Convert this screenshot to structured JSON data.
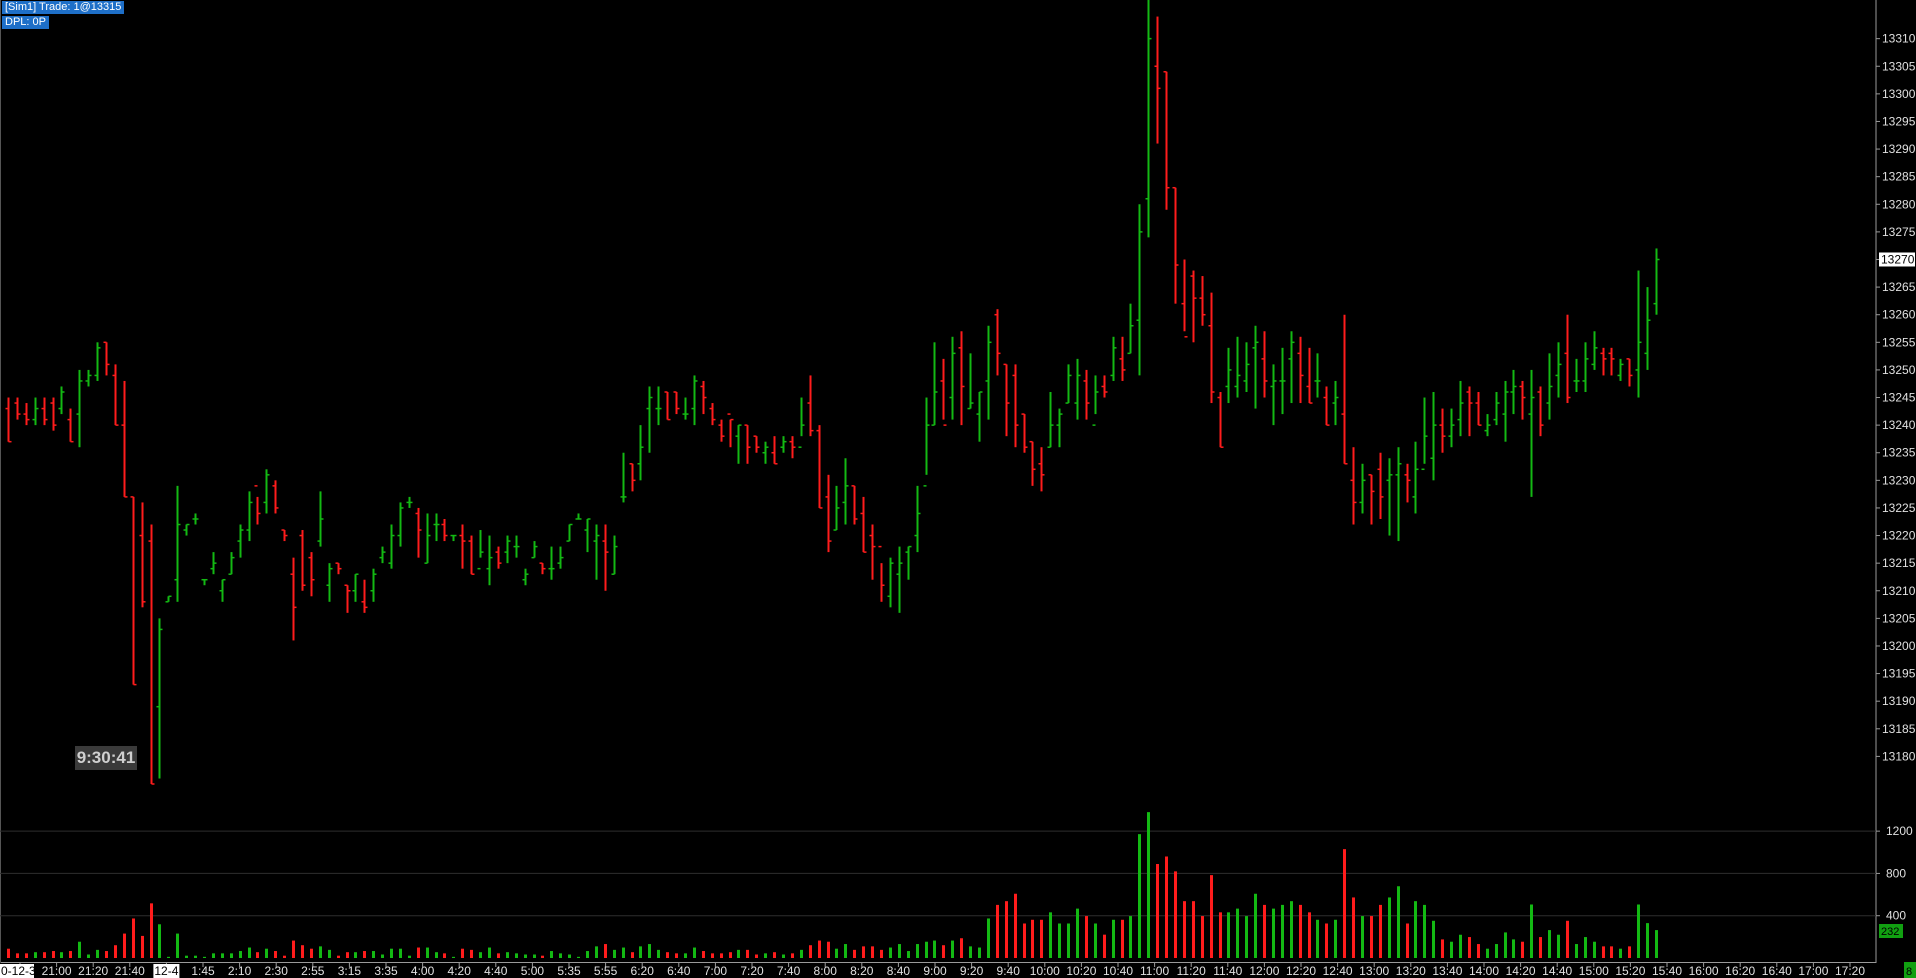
{
  "status": {
    "line1": "[Sim1]  Trade: 1@13315",
    "line2": "DPL: 0P"
  },
  "time_box": "9:30:41",
  "chart_data": [
    {
      "type": "ohlc",
      "price_axis": {
        "ticks": [
          13180,
          13185,
          13190,
          13195,
          13200,
          13205,
          13210,
          13215,
          13220,
          13225,
          13230,
          13235,
          13240,
          13245,
          13250,
          13255,
          13260,
          13265,
          13270,
          13275,
          13280,
          13285,
          13290,
          13295,
          13300,
          13305,
          13310
        ],
        "range": [
          13175,
          13317
        ],
        "current_price": "13270"
      },
      "time_axis": [
        "0-12-3",
        "21:00",
        "21:20",
        "21:40",
        "12-4",
        "1:45",
        "2:10",
        "2:30",
        "2:55",
        "3:15",
        "3:35",
        "4:00",
        "4:20",
        "4:40",
        "5:00",
        "5:35",
        "5:55",
        "6:20",
        "6:40",
        "7:00",
        "7:20",
        "7:40",
        "8:00",
        "8:20",
        "8:40",
        "9:00",
        "9:20",
        "9:40",
        "10:00",
        "10:20",
        "10:40",
        "11:00",
        "11:20",
        "11:40",
        "12:00",
        "12:20",
        "12:40",
        "13:00",
        "13:20",
        "13:40",
        "14:00",
        "14:20",
        "14:40",
        "15:00",
        "15:20",
        "15:40",
        "16:00",
        "16:20",
        "16:40",
        "17:00",
        "17:20"
      ],
      "bars": [
        [
          13243,
          13237,
          13245,
          13237
        ],
        [
          13244,
          13242,
          13245,
          13241
        ],
        [
          13242,
          13241,
          13244,
          13240
        ],
        [
          13241,
          13243,
          13245,
          13240
        ],
        [
          13243,
          13241,
          13245,
          13240
        ],
        [
          13244,
          13240,
          13245,
          13239
        ],
        [
          13243,
          13246,
          13247,
          13242
        ],
        [
          13241,
          13237,
          13243,
          13237
        ],
        [
          13242,
          13248,
          13250,
          13236
        ],
        [
          13248,
          13249,
          13250,
          13247
        ],
        [
          13249,
          13254,
          13255,
          13248
        ],
        [
          13255,
          13251,
          13255,
          13249
        ],
        [
          13249,
          13240,
          13251,
          13240
        ],
        [
          13240,
          13227,
          13248,
          13227
        ],
        [
          13227,
          13193,
          13227,
          13193
        ],
        [
          13220,
          13208,
          13226,
          13207
        ],
        [
          13219,
          13175,
          13222,
          13175
        ],
        [
          13189,
          13203,
          13205,
          13176
        ],
        [
          13208,
          13209,
          13209,
          13208
        ],
        [
          13212,
          13222,
          13229,
          13208
        ],
        [
          13221,
          13222,
          13222,
          13220
        ],
        [
          13223,
          13223,
          13224,
          13222
        ],
        [
          13212,
          13212,
          13212,
          13211
        ],
        [
          13214,
          13215,
          13217,
          13213
        ],
        [
          13210,
          13212,
          13212,
          13208
        ],
        [
          13213,
          13216,
          13217,
          13213
        ],
        [
          13219,
          13221,
          13222,
          13216
        ],
        [
          13221,
          13226,
          13228,
          13219
        ],
        [
          13229,
          13224,
          13227,
          13222
        ],
        [
          13226,
          13231,
          13232,
          13224
        ],
        [
          13229,
          13225,
          13230,
          13224
        ],
        [
          13221,
          13220,
          13221,
          13219
        ],
        [
          13213,
          13207,
          13216,
          13201
        ],
        [
          13220,
          13211,
          13221,
          13210
        ],
        [
          13216,
          13212,
          13217,
          13209
        ],
        [
          13219,
          13223,
          13228,
          13218
        ],
        [
          13211,
          13214,
          13215,
          13208
        ],
        [
          13215,
          13214,
          13215,
          13213
        ],
        [
          13211,
          13210,
          13211,
          13206
        ],
        [
          13210,
          13213,
          13213,
          13208
        ],
        [
          13208,
          13207,
          13212,
          13206
        ],
        [
          13210,
          13213,
          13214,
          13208
        ],
        [
          13216,
          13217,
          13218,
          13215
        ],
        [
          13215,
          13220,
          13222,
          13214
        ],
        [
          13220,
          13225,
          13226,
          13218
        ],
        [
          13226,
          13226,
          13227,
          13225
        ],
        [
          13224,
          13221,
          13225,
          13216
        ],
        [
          13215,
          13220,
          13224,
          13215
        ],
        [
          13222,
          13222,
          13224,
          13219
        ],
        [
          13222,
          13220,
          13223,
          13219
        ],
        [
          13220,
          13220,
          13220,
          13219
        ],
        [
          13220,
          13219,
          13222,
          13214
        ],
        [
          13219,
          13213,
          13220,
          13213
        ],
        [
          13214,
          13217,
          13221,
          13216
        ],
        [
          13214,
          13216,
          13220,
          13211
        ],
        [
          13217,
          13215,
          13218,
          13214
        ],
        [
          13217,
          13219,
          13220,
          13215
        ],
        [
          13218,
          13218,
          13220,
          13216
        ],
        [
          13212,
          13213,
          13214,
          13211
        ],
        [
          13216,
          13218,
          13219,
          13216
        ],
        [
          13215,
          13214,
          13215,
          13213
        ],
        [
          13214,
          13214,
          13218,
          13212
        ],
        [
          13215,
          13216,
          13218,
          13214
        ],
        [
          13219,
          13222,
          13222,
          13219
        ],
        [
          13223,
          13223,
          13224,
          13223
        ],
        [
          13221,
          13223,
          13223,
          13217
        ],
        [
          13219,
          13220,
          13222,
          13212
        ],
        [
          13219,
          13217,
          13222,
          13210
        ],
        [
          13213,
          13218,
          13220,
          13213
        ],
        [
          13227,
          13227,
          13235,
          13226
        ],
        [
          13233,
          13230,
          13233,
          13228
        ],
        [
          13233,
          13236,
          13240,
          13230
        ],
        [
          13243,
          13245,
          13247,
          13235
        ],
        [
          13243,
          13243,
          13247,
          13240
        ],
        [
          13246,
          13241,
          13246,
          13241
        ],
        [
          13246,
          13243,
          13246,
          13242
        ],
        [
          13242,
          13242,
          13245,
          13241
        ],
        [
          13243,
          13248,
          13249,
          13240
        ],
        [
          13247,
          13245,
          13248,
          13242
        ],
        [
          13243,
          13241,
          13244,
          13240
        ],
        [
          13240,
          13238,
          13241,
          13237
        ],
        [
          13242,
          13241,
          13241,
          13236
        ],
        [
          13238,
          13240,
          13240,
          13233
        ],
        [
          13240,
          13236,
          13240,
          13233
        ],
        [
          13238,
          13236,
          13238,
          13235
        ],
        [
          13235,
          13236,
          13237,
          13233
        ],
        [
          13235,
          13233,
          13238,
          13233
        ],
        [
          13236,
          13237,
          13238,
          13235
        ],
        [
          13237,
          13236,
          13238,
          13234
        ],
        [
          13236,
          13240,
          13245,
          13238
        ],
        [
          13244,
          13239,
          13249,
          13238
        ],
        [
          13239,
          13225,
          13240,
          13225
        ],
        [
          13227,
          13219,
          13231,
          13217
        ],
        [
          13221,
          13225,
          13229,
          13221
        ],
        [
          13226,
          13229,
          13234,
          13222
        ],
        [
          13229,
          13223,
          13229,
          13222
        ],
        [
          13224,
          13217,
          13227,
          13217
        ],
        [
          13220,
          13218,
          13222,
          13212
        ],
        [
          13218,
          13211,
          13215,
          13208
        ],
        [
          13209,
          13215,
          13216,
          13207
        ],
        [
          13213,
          13215,
          13218,
          13206
        ],
        [
          13217,
          13218,
          13218,
          13212
        ],
        [
          13220,
          13224,
          13229,
          13217
        ],
        [
          13229,
          13240,
          13245,
          13231
        ],
        [
          13240,
          13246,
          13255,
          13240
        ],
        [
          13248,
          13240,
          13252,
          13241
        ],
        [
          13245,
          13253,
          13256,
          13241
        ],
        [
          13254,
          13247,
          13257,
          13240
        ],
        [
          13243,
          13244,
          13253,
          13243
        ],
        [
          13242,
          13246,
          13246,
          13237
        ],
        [
          13248,
          13255,
          13258,
          13241
        ],
        [
          13260,
          13253,
          13261,
          13249
        ],
        [
          13251,
          13244,
          13251,
          13238
        ],
        [
          13249,
          13240,
          13251,
          13236
        ],
        [
          13242,
          13236,
          13242,
          13235
        ],
        [
          13237,
          13232,
          13237,
          13229
        ],
        [
          13233,
          13231,
          13236,
          13228
        ],
        [
          13236,
          13240,
          13246,
          13236
        ],
        [
          13240,
          13242,
          13243,
          13236
        ],
        [
          13244,
          13249,
          13251,
          13244
        ],
        [
          13244,
          13249,
          13252,
          13241
        ],
        [
          13248,
          13244,
          13250,
          13241
        ],
        [
          13240,
          13246,
          13249,
          13242
        ],
        [
          13247,
          13246,
          13249,
          13245
        ],
        [
          13249,
          13254,
          13256,
          13248
        ],
        [
          13252,
          13250,
          13256,
          13248
        ],
        [
          13253,
          13258,
          13262,
          13253
        ],
        [
          13259,
          13275,
          13280,
          13249
        ],
        [
          13281,
          13310,
          13317,
          13274
        ],
        [
          13305,
          13301,
          13314,
          13291
        ],
        [
          13304,
          13283,
          13304,
          13279
        ],
        [
          13283,
          13269,
          13283,
          13262
        ],
        [
          13262,
          13256,
          13270,
          13257
        ],
        [
          13267,
          13263,
          13268,
          13255
        ],
        [
          13263,
          13260,
          13267,
          13258
        ],
        [
          13258,
          13246,
          13264,
          13244
        ],
        [
          13245,
          13236,
          13246,
          13236
        ],
        [
          13247,
          13250,
          13254,
          13244
        ],
        [
          13247,
          13249,
          13256,
          13245
        ],
        [
          13248,
          13251,
          13255,
          13246
        ],
        [
          13254,
          13255,
          13258,
          13243
        ],
        [
          13252,
          13248,
          13257,
          13245
        ],
        [
          13247,
          13248,
          13251,
          13240
        ],
        [
          13248,
          13248,
          13254,
          13242
        ],
        [
          13252,
          13255,
          13257,
          13244
        ],
        [
          13253,
          13249,
          13256,
          13244
        ],
        [
          13247,
          13244,
          13254,
          13244
        ],
        [
          13248,
          13248,
          13253,
          13245
        ],
        [
          13245,
          13240,
          13247,
          13240
        ],
        [
          13244,
          13245,
          13248,
          13240
        ],
        [
          13242,
          13233,
          13260,
          13233
        ],
        [
          13230,
          13226,
          13236,
          13222
        ],
        [
          13226,
          13230,
          13233,
          13224
        ],
        [
          13231,
          13228,
          13231,
          13222
        ],
        [
          13232,
          13227,
          13235,
          13223
        ],
        [
          13230,
          13231,
          13234,
          13220
        ],
        [
          13231,
          13233,
          13236,
          13219
        ],
        [
          13231,
          13230,
          13233,
          13226
        ],
        [
          13227,
          13232,
          13237,
          13224
        ],
        [
          13232,
          13238,
          13245,
          13233
        ],
        [
          13234,
          13240,
          13246,
          13230
        ],
        [
          13240,
          13238,
          13243,
          13235
        ],
        [
          13238,
          13240,
          13243,
          13236
        ],
        [
          13241,
          13244,
          13248,
          13238
        ],
        [
          13246,
          13244,
          13247,
          13238
        ],
        [
          13244,
          13240,
          13246,
          13240
        ],
        [
          13239,
          13240,
          13242,
          13238
        ],
        [
          13241,
          13244,
          13246,
          13240
        ],
        [
          13242,
          13246,
          13248,
          13237
        ],
        [
          13246,
          13247,
          13250,
          13242
        ],
        [
          13247,
          13245,
          13248,
          13241
        ],
        [
          13242,
          13245,
          13250,
          13227
        ],
        [
          13246,
          13240,
          13247,
          13238
        ],
        [
          13244,
          13247,
          13253,
          13241
        ],
        [
          13249,
          13251,
          13255,
          13245
        ],
        [
          13253,
          13245,
          13260,
          13244
        ],
        [
          13248,
          13248,
          13252,
          13246
        ],
        [
          13248,
          13252,
          13255,
          13246
        ],
        [
          13251,
          13254,
          13257,
          13250
        ],
        [
          13253,
          13252,
          13254,
          13249
        ],
        [
          13253,
          13252,
          13254,
          13249
        ],
        [
          13249,
          13251,
          13252,
          13248
        ],
        [
          13252,
          13249,
          13252,
          13247
        ],
        [
          13250,
          13255,
          13268,
          13245
        ],
        [
          13253,
          13259,
          13265,
          13250
        ],
        [
          13262,
          13270,
          13272,
          13260
        ]
      ]
    },
    {
      "type": "bar",
      "name": "volume",
      "axis_ticks": [
        400,
        800,
        1200
      ],
      "ylim": [
        0,
        1400
      ],
      "current_value": "232",
      "last_value": "8"
    }
  ]
}
